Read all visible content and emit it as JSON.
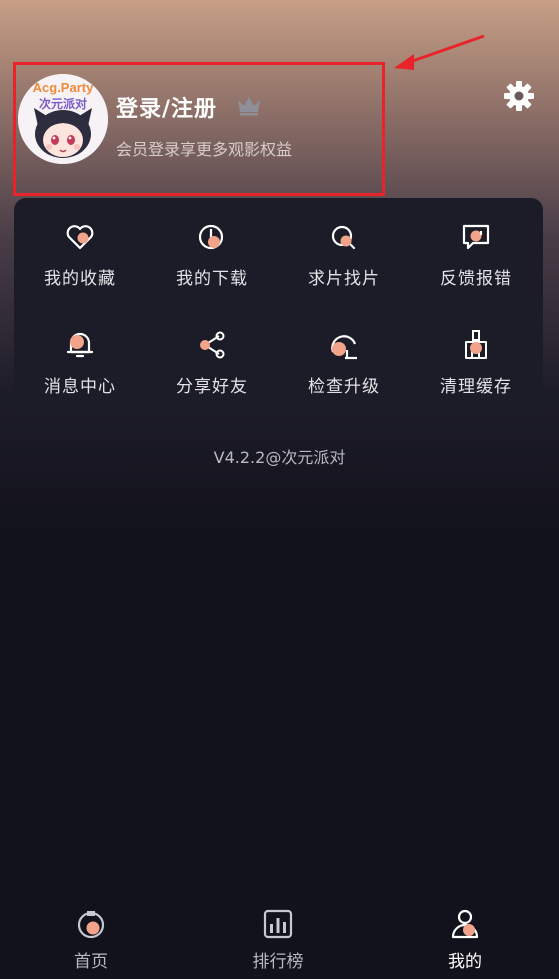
{
  "profile": {
    "title": "登录/注册",
    "subtitle": "会员登录享更多观影权益",
    "avatar_text_top": "Acg.Party",
    "avatar_text_bottom": "次元派对"
  },
  "icons": {
    "settings": "gear-icon",
    "vip": "crown-icon"
  },
  "menu": {
    "items": [
      {
        "label": "我的收藏",
        "icon": "heart-icon"
      },
      {
        "label": "我的下载",
        "icon": "download-icon"
      },
      {
        "label": "求片找片",
        "icon": "search-film-icon"
      },
      {
        "label": "反馈报错",
        "icon": "feedback-icon"
      },
      {
        "label": "消息中心",
        "icon": "bell-icon"
      },
      {
        "label": "分享好友",
        "icon": "share-icon"
      },
      {
        "label": "检查升级",
        "icon": "upgrade-icon"
      },
      {
        "label": "清理缓存",
        "icon": "broom-icon"
      }
    ]
  },
  "version": "V4.2.2@次元派对",
  "bottom_nav": {
    "items": [
      {
        "label": "首页",
        "icon": "home-icon",
        "active": false
      },
      {
        "label": "排行榜",
        "icon": "ranking-icon",
        "active": false
      },
      {
        "label": "我的",
        "icon": "profile-icon",
        "active": true
      }
    ]
  },
  "colors": {
    "accent": "#f2a48a",
    "annotation": "#e8242a",
    "card": "#1b1c28",
    "background": "#12121c"
  }
}
